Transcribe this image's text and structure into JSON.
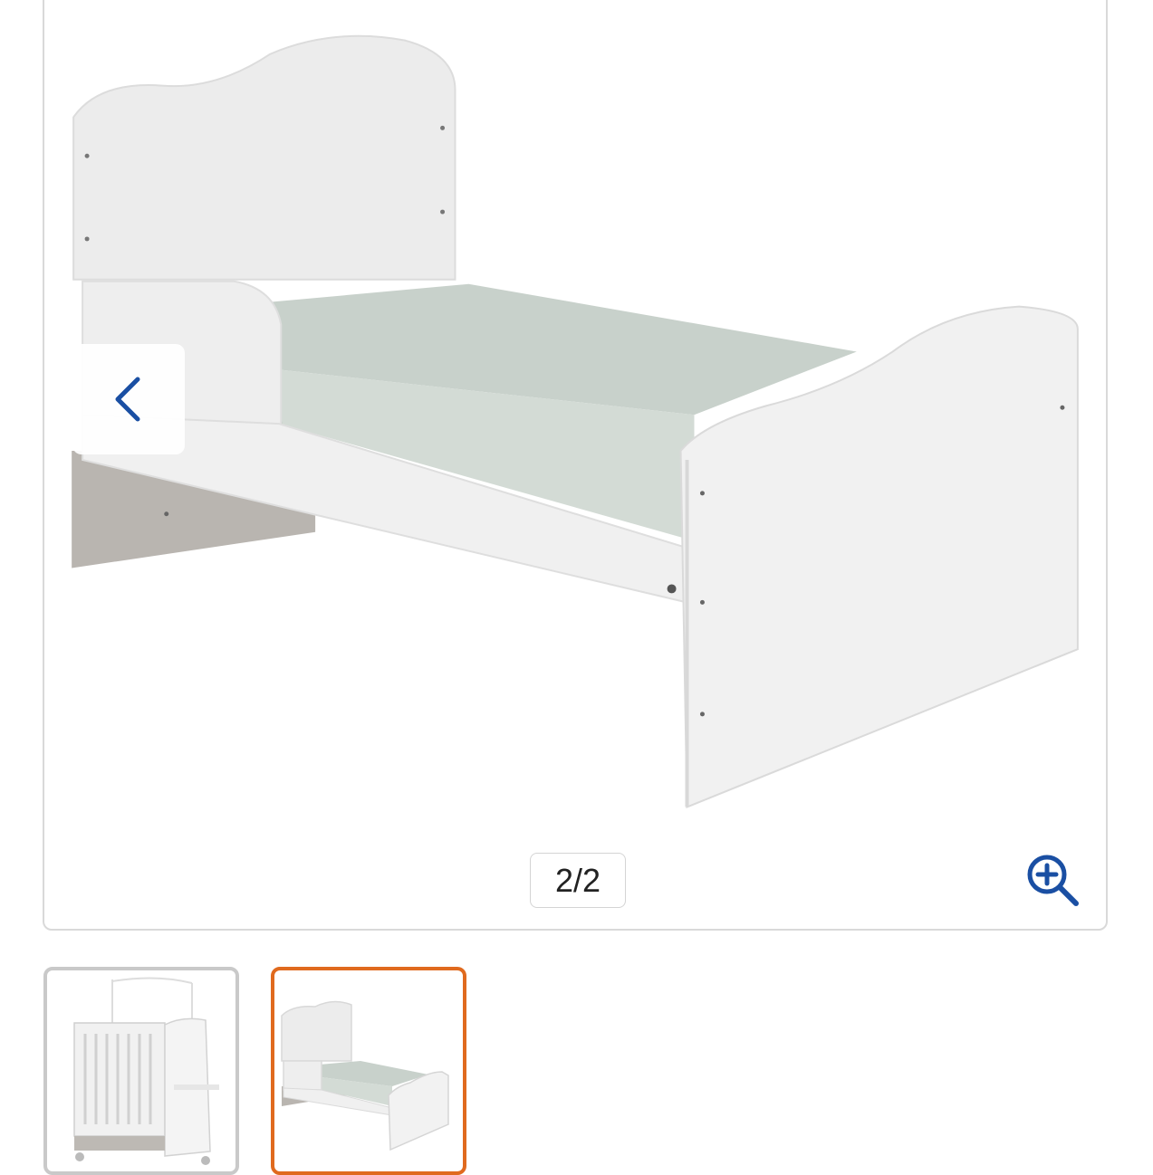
{
  "gallery": {
    "counter_text": "2/2",
    "current_index": 2,
    "total_images": 2,
    "prev_icon": "chevron-left-icon",
    "zoom_icon": "zoom-in-icon",
    "accent_color": "#1a4fa3",
    "selected_border_color": "#e06a1e",
    "thumbnails": [
      {
        "name": "crib",
        "selected": false
      },
      {
        "name": "toddler-bed",
        "selected": true
      }
    ]
  }
}
